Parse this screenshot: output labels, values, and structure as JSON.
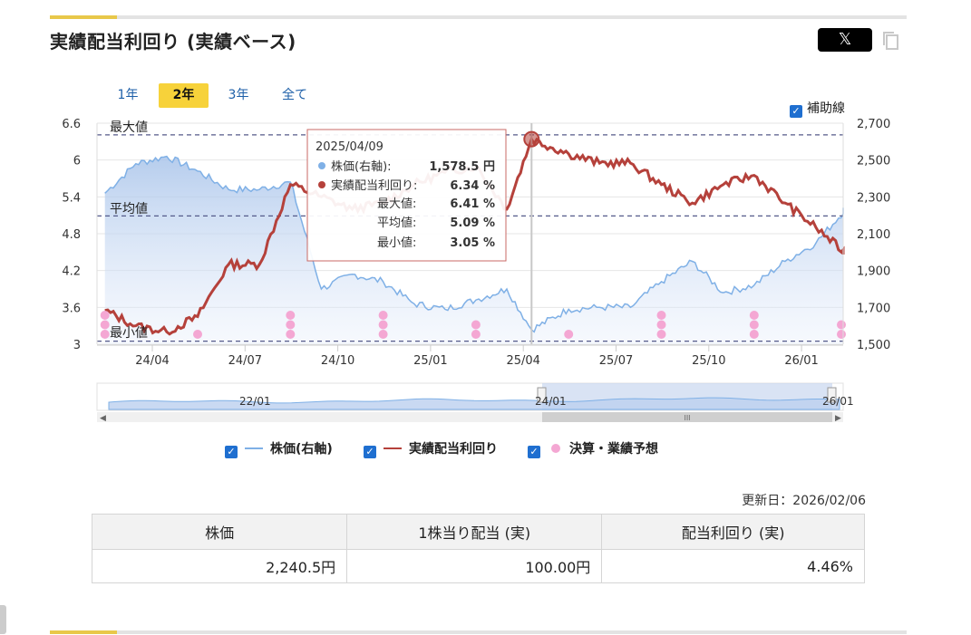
{
  "header": {
    "title": "実績配当利回り (実績ベース)",
    "share_button_label": "𝕏",
    "copy_icon": "copy-icon"
  },
  "periods": [
    {
      "label": "1年",
      "active": false
    },
    {
      "label": "2年",
      "active": true
    },
    {
      "label": "3年",
      "active": false
    },
    {
      "label": "全て",
      "active": false
    }
  ],
  "aux_lines": {
    "label": "補助線",
    "checked": true
  },
  "annotations": {
    "max_label": "最大値",
    "avg_label": "平均値",
    "min_label": "最小値"
  },
  "tooltip": {
    "date": "2025/04/09",
    "rows": [
      {
        "label": "株価(右軸):",
        "value": "1,578.5 円",
        "color": "#7fb0e6"
      },
      {
        "label": "実績配当利回り:",
        "value": "6.34 %",
        "color": "#b5413b"
      },
      {
        "label": "最大値:",
        "value": "6.41 %"
      },
      {
        "label": "平均値:",
        "value": "5.09 %"
      },
      {
        "label": "最小値:",
        "value": "3.05 %"
      }
    ]
  },
  "legend": [
    {
      "label": "株価(右軸)",
      "color": "#7fb0e6",
      "kind": "line"
    },
    {
      "label": "実績配当利回り",
      "color": "#b5413b",
      "kind": "line"
    },
    {
      "label": "決算・業績予想",
      "color": "#f4a7d3",
      "kind": "dot"
    }
  ],
  "navigator": {
    "labels": [
      "22/01",
      "24/01",
      "26/01"
    ]
  },
  "updated": "更新日：2026/02/06",
  "summary": {
    "headers": [
      "株価",
      "1株当り配当 (実)",
      "配当利回り (実)"
    ],
    "values": [
      "2,240.5円",
      "100.00円",
      "4.46%"
    ]
  },
  "colors": {
    "accent": "#e8c84a",
    "yield": "#b5413b",
    "price": "#7fb0e6",
    "event": "#f4a7d3"
  },
  "chart_data": {
    "type": "line",
    "x_ticks": [
      "24/04",
      "24/07",
      "24/10",
      "25/01",
      "25/04",
      "25/07",
      "25/10",
      "26/01"
    ],
    "y_left": {
      "ticks": [
        "3",
        "3.6",
        "4.2",
        "4.8",
        "5.4",
        "6",
        "6.6"
      ],
      "range": [
        3,
        6.6
      ]
    },
    "y_right": {
      "ticks": [
        "1,500",
        "1,700",
        "1,900",
        "2,100",
        "2,300",
        "2,500",
        "2,700"
      ],
      "range": [
        1500,
        2700
      ]
    },
    "reference_lines": {
      "max": 6.41,
      "avg": 5.09,
      "min": 3.05
    },
    "series": [
      {
        "name": "株価(右軸)",
        "axis": "right",
        "x": [
          "24/02",
          "24/03",
          "24/04",
          "24/05",
          "24/06",
          "24/07",
          "24/08",
          "24/09",
          "24/10",
          "24/11",
          "24/12",
          "25/01",
          "25/02",
          "25/03",
          "25/04/09",
          "25/05",
          "25/06",
          "25/07",
          "25/08",
          "25/09",
          "25/10",
          "25/11",
          "25/12",
          "26/01",
          "26/02"
        ],
        "values": [
          2320,
          2480,
          2520,
          2440,
          2340,
          2340,
          2380,
          1800,
          1880,
          1840,
          1720,
          1690,
          1740,
          1800,
          1578.5,
          1690,
          1700,
          1700,
          1840,
          1950,
          1780,
          1820,
          1950,
          2050,
          2240.5
        ]
      },
      {
        "name": "実績配当利回り",
        "axis": "left",
        "x": [
          "24/02",
          "24/03",
          "24/04",
          "24/05",
          "24/06",
          "24/07",
          "24/08",
          "24/09",
          "24/10",
          "24/11",
          "24/12",
          "25/01",
          "25/02",
          "25/03",
          "25/04/09",
          "25/05",
          "25/06",
          "25/07",
          "25/08",
          "25/09",
          "25/10",
          "25/11",
          "25/12",
          "26/01",
          "26/02"
        ],
        "values": [
          3.55,
          3.3,
          3.2,
          3.45,
          4.3,
          4.3,
          5.6,
          5.4,
          5.2,
          5.3,
          5.6,
          5.8,
          5.9,
          5.2,
          6.34,
          6.1,
          5.95,
          5.95,
          5.6,
          5.3,
          5.6,
          5.75,
          5.3,
          4.9,
          4.46
        ]
      }
    ],
    "events": {
      "name": "決算・業績予想",
      "x": [
        "24/02",
        "24/05",
        "24/08",
        "24/11",
        "25/02",
        "25/05",
        "25/08",
        "25/11",
        "26/02"
      ],
      "counts": [
        3,
        1,
        3,
        3,
        2,
        1,
        3,
        3,
        2
      ]
    }
  }
}
